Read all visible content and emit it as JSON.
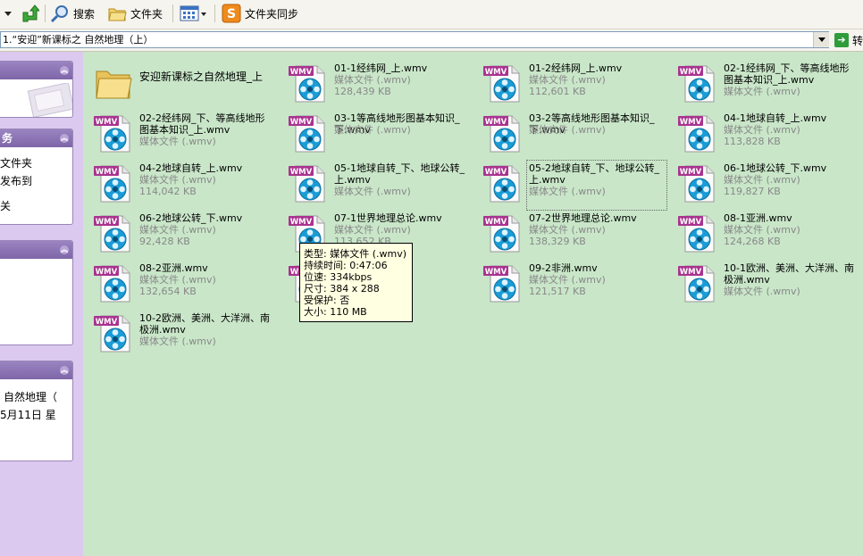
{
  "toolbar": {
    "search_label": "搜索",
    "folders_label": "文件夹",
    "sync_label": "文件夹同步"
  },
  "address": {
    "value": "1.“安迎”新课标之 自然地理（上）",
    "go_label": "转"
  },
  "left_panels": [
    {
      "title": "",
      "items": []
    },
    {
      "title": "务",
      "items": [
        "文件夹",
        "发布到",
        "关"
      ]
    },
    {
      "title": "",
      "items": []
    },
    {
      "title": "",
      "items": [
        "自然地理（",
        "",
        "5月11日 星"
      ]
    }
  ],
  "folder": {
    "name": "安迎新课标之自然地理_上"
  },
  "files": [
    {
      "name": "01-1经纬网_上.wmv",
      "type": "媒体文件 (.wmv)",
      "size": "128,439 KB"
    },
    {
      "name": "01-2经纬网_上.wmv",
      "type": "媒体文件 (.wmv)",
      "size": "112,601 KB"
    },
    {
      "name": "02-1经纬网_下、等高线地形图基本知识_上.wmv",
      "type": "媒体文件 (.wmv)",
      "size": ""
    },
    {
      "name": "02-2经纬网_下、等高线地形图基本知识_上.wmv",
      "type": "媒体文件 (.wmv)",
      "size": ""
    },
    {
      "name": "03-1等高线地形图基本知识_下.wmv",
      "type": "媒体文件 (.wmv)",
      "size": ""
    },
    {
      "name": "03-2等高线地形图基本知识_下.wmv",
      "type": "媒体文件 (.wmv)",
      "size": ""
    },
    {
      "name": "04-1地球自转_上.wmv",
      "type": "媒体文件 (.wmv)",
      "size": "113,828 KB"
    },
    {
      "name": "04-2地球自转_上.wmv",
      "type": "媒体文件 (.wmv)",
      "size": "114,042 KB"
    },
    {
      "name": "05-1地球自转_下、地球公转_上.wmv",
      "type": "媒体文件 (.wmv)",
      "size": ""
    },
    {
      "name": "05-2地球自转_下、地球公转_上.wmv",
      "type": "媒体文件 (.wmv)",
      "size": ""
    },
    {
      "name": "06-1地球公转_下.wmv",
      "type": "媒体文件 (.wmv)",
      "size": "119,827 KB"
    },
    {
      "name": "06-2地球公转_下.wmv",
      "type": "媒体文件 (.wmv)",
      "size": "92,428 KB"
    },
    {
      "name": "07-1世界地理总论.wmv",
      "type": "媒体文件 (.wmv)",
      "size": "113,652 KB"
    },
    {
      "name": "07-2世界地理总论.wmv",
      "type": "媒体文件 (.wmv)",
      "size": "138,329 KB"
    },
    {
      "name": "08-1亚洲.wmv",
      "type": "媒体文件 (.wmv)",
      "size": "124,268 KB"
    },
    {
      "name": "08-2亚洲.wmv",
      "type": "媒体文件 (.wmv)",
      "size": "132,654 KB"
    },
    {
      "name": "",
      "type": "",
      "size": ""
    },
    {
      "name": "09-2非洲.wmv",
      "type": "媒体文件 (.wmv)",
      "size": "121,517 KB"
    },
    {
      "name": "10-1欧洲、美洲、大洋洲、南极洲.wmv",
      "type": "媒体文件 (.wmv)",
      "size": ""
    },
    {
      "name": "10-2欧洲、美洲、大洋洲、南极洲.wmv",
      "type": "媒体文件 (.wmv)",
      "size": ""
    }
  ],
  "wmv_badge": "WMV",
  "tooltip": {
    "type": "类型: 媒体文件 (.wmv)",
    "duration": "持续时间: 0:47:06",
    "bitrate": "位速: 334kbps",
    "dimensions": "尺寸: 384 x 288",
    "protected": "受保护: 否",
    "size": "大小: 110 MB"
  },
  "colors": {
    "background": "#c9e6c9",
    "left_pane": "#dcc9f0",
    "wmv_badge": "#a9338f",
    "tooltip_bg": "#ffffe1"
  }
}
